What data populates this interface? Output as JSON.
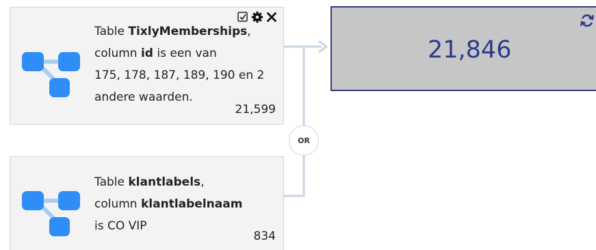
{
  "segments": [
    {
      "prefix": "Table ",
      "table": "TixlyMemberships",
      "comma": ",",
      "mid": "column ",
      "column": "id",
      "rest": " is een van",
      "line3": "175, 178, 187, 189, 190 en 2",
      "line4": "andere waarden.",
      "count": "21,599"
    },
    {
      "prefix": "Table ",
      "table": "klantlabels",
      "comma": ",",
      "mid": "column ",
      "column": "klantlabelnaam",
      "rest": "",
      "line3": "is CO VIP",
      "count": "834"
    }
  ],
  "operator": "OR",
  "result": {
    "value": "21,846"
  },
  "colors": {
    "icon": "#2f8ef5",
    "icon_link": "#a9ccf3",
    "result_border": "#2f3980",
    "result_text": "#2b3a8c",
    "result_bg": "#c6c6c6",
    "card_bg": "#f3f3f3"
  },
  "icons": {
    "segment": "hierarchy-icon",
    "checkbox": "checkbox-icon",
    "settings": "gear-icon",
    "close": "close-icon",
    "refresh": "refresh-icon"
  }
}
